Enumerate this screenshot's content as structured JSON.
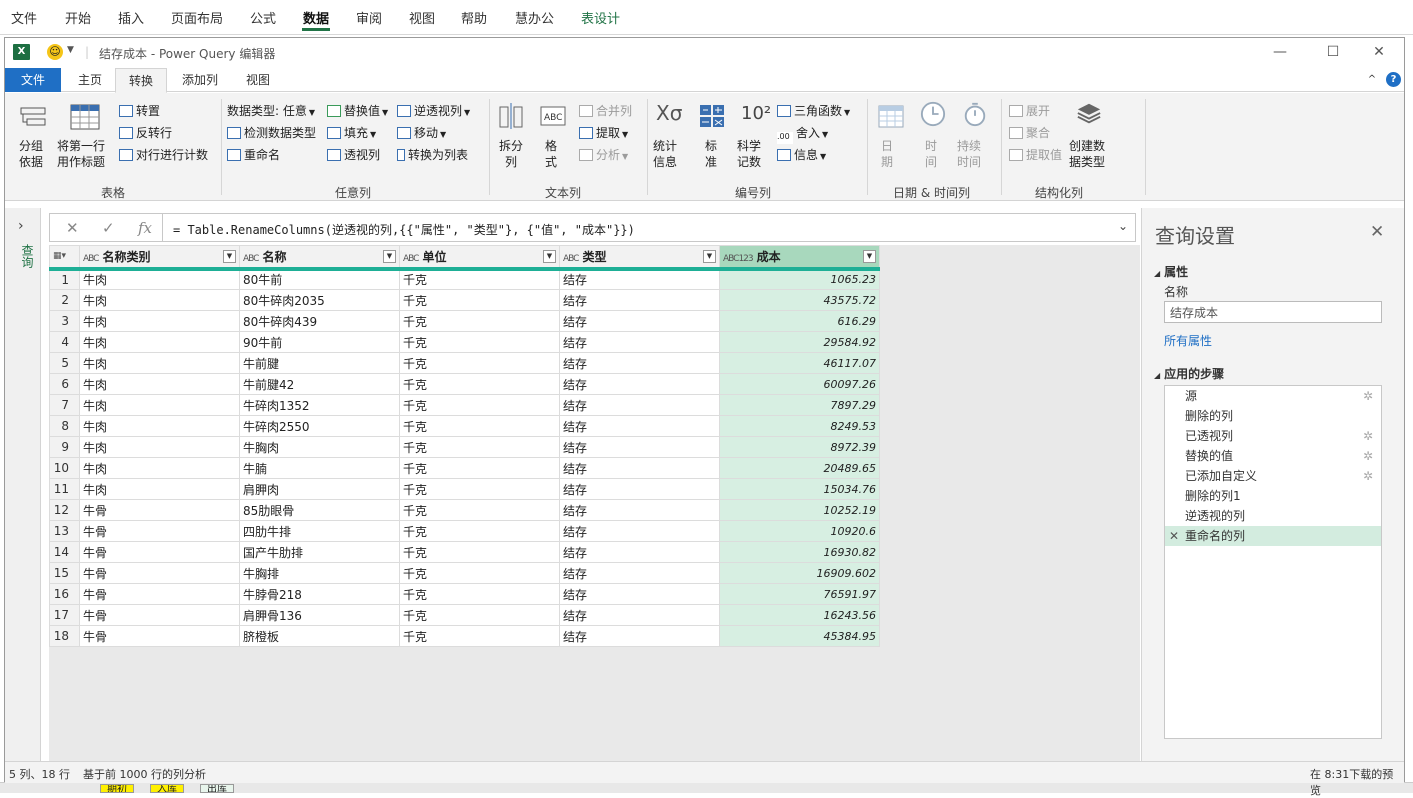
{
  "excel_menu": [
    "文件",
    "开始",
    "插入",
    "页面布局",
    "公式",
    "数据",
    "审阅",
    "视图",
    "帮助",
    "慧办公",
    "表设计"
  ],
  "sheet_tabs": [
    "期初",
    "入库",
    "出库"
  ],
  "window": {
    "title": "结存成本 - Power Query 编辑器"
  },
  "ribbon_tabs": [
    "文件",
    "主页",
    "转换",
    "添加列",
    "视图"
  ],
  "ribbon": {
    "table_group": {
      "label": "表格",
      "group_by": "分组\n依据",
      "use_first_row": "将第一行\n用作标题",
      "transpose": "转置",
      "reverse_rows": "反转行",
      "count_rows": "对行进行计数"
    },
    "any_col_group": {
      "label": "任意列",
      "data_type": "数据类型: 任意",
      "detect_type": "检测数据类型",
      "rename": "重命名",
      "replace_values": "替换值",
      "fill": "填充",
      "pivot": "透视列",
      "unpivot": "逆透视列",
      "move": "移动",
      "to_list": "转换为列表"
    },
    "text_col_group": {
      "label": "文本列",
      "split": "拆分\n列",
      "format": "格\n式",
      "merge": "合并列",
      "extract": "提取",
      "parse": "分析"
    },
    "num_col_group": {
      "label": "编号列",
      "stats": "统计\n信息",
      "standard": "标\n准",
      "scientific": "科学\n记数",
      "trig": "三角函数",
      "round": "舍入",
      "info": "信息"
    },
    "datetime_group": {
      "label": "日期 & 时间列",
      "date": "日\n期",
      "time": "时\n间",
      "duration": "持续\n时间"
    },
    "struct_group": {
      "label": "结构化列",
      "expand": "展开",
      "aggregate": "聚合",
      "extract_values": "提取值",
      "create_type": "创建数\n据类型"
    }
  },
  "nav_label": "查询",
  "formula": "= Table.RenameColumns(逆透视的列,{{\"属性\", \"类型\"}, {\"值\", \"成本\"}})",
  "columns": [
    {
      "type": "ABC",
      "name": "名称类别"
    },
    {
      "type": "ABC",
      "name": "名称"
    },
    {
      "type": "ABC",
      "name": "单位"
    },
    {
      "type": "ABC",
      "name": "类型"
    },
    {
      "type": "ABC123",
      "name": "成本"
    }
  ],
  "rows": [
    [
      "1",
      "牛肉",
      "80牛前",
      "千克",
      "结存",
      "1065.23"
    ],
    [
      "2",
      "牛肉",
      "80牛碎肉2035",
      "千克",
      "结存",
      "43575.72"
    ],
    [
      "3",
      "牛肉",
      "80牛碎肉439",
      "千克",
      "结存",
      "616.29"
    ],
    [
      "4",
      "牛肉",
      "90牛前",
      "千克",
      "结存",
      "29584.92"
    ],
    [
      "5",
      "牛肉",
      "牛前腱",
      "千克",
      "结存",
      "46117.07"
    ],
    [
      "6",
      "牛肉",
      "牛前腱42",
      "千克",
      "结存",
      "60097.26"
    ],
    [
      "7",
      "牛肉",
      "牛碎肉1352",
      "千克",
      "结存",
      "7897.29"
    ],
    [
      "8",
      "牛肉",
      "牛碎肉2550",
      "千克",
      "结存",
      "8249.53"
    ],
    [
      "9",
      "牛肉",
      "牛胸肉",
      "千克",
      "结存",
      "8972.39"
    ],
    [
      "10",
      "牛肉",
      "牛腩",
      "千克",
      "结存",
      "20489.65"
    ],
    [
      "11",
      "牛肉",
      "肩胛肉",
      "千克",
      "结存",
      "15034.76"
    ],
    [
      "12",
      "牛骨",
      "85肋眼骨",
      "千克",
      "结存",
      "10252.19"
    ],
    [
      "13",
      "牛骨",
      "四肋牛排",
      "千克",
      "结存",
      "10920.6"
    ],
    [
      "14",
      "牛骨",
      "国产牛肋排",
      "千克",
      "结存",
      "16930.82"
    ],
    [
      "15",
      "牛骨",
      "牛胸排",
      "千克",
      "结存",
      "16909.602"
    ],
    [
      "16",
      "牛骨",
      "牛脖骨218",
      "千克",
      "结存",
      "76591.97"
    ],
    [
      "17",
      "牛骨",
      "肩胛骨136",
      "千克",
      "结存",
      "16243.56"
    ],
    [
      "18",
      "牛骨",
      "脐橙板",
      "千克",
      "结存",
      "45384.95"
    ]
  ],
  "query_settings": {
    "title": "查询设置",
    "props_header": "属性",
    "name_label": "名称",
    "name_value": "结存成本",
    "all_props": "所有属性",
    "steps_header": "应用的步骤",
    "steps": [
      {
        "name": "源",
        "gear": true
      },
      {
        "name": "删除的列",
        "gear": false
      },
      {
        "name": "已透视列",
        "gear": true
      },
      {
        "name": "替换的值",
        "gear": true
      },
      {
        "name": "已添加自定义",
        "gear": true
      },
      {
        "name": "删除的列1",
        "gear": false
      },
      {
        "name": "逆透视的列",
        "gear": false
      },
      {
        "name": "重命名的列",
        "gear": false,
        "selected": true
      }
    ]
  },
  "status": {
    "left1": "5 列、18 行",
    "left2": "基于前 1000 行的列分析",
    "right": "在 8:31下载的预览"
  }
}
